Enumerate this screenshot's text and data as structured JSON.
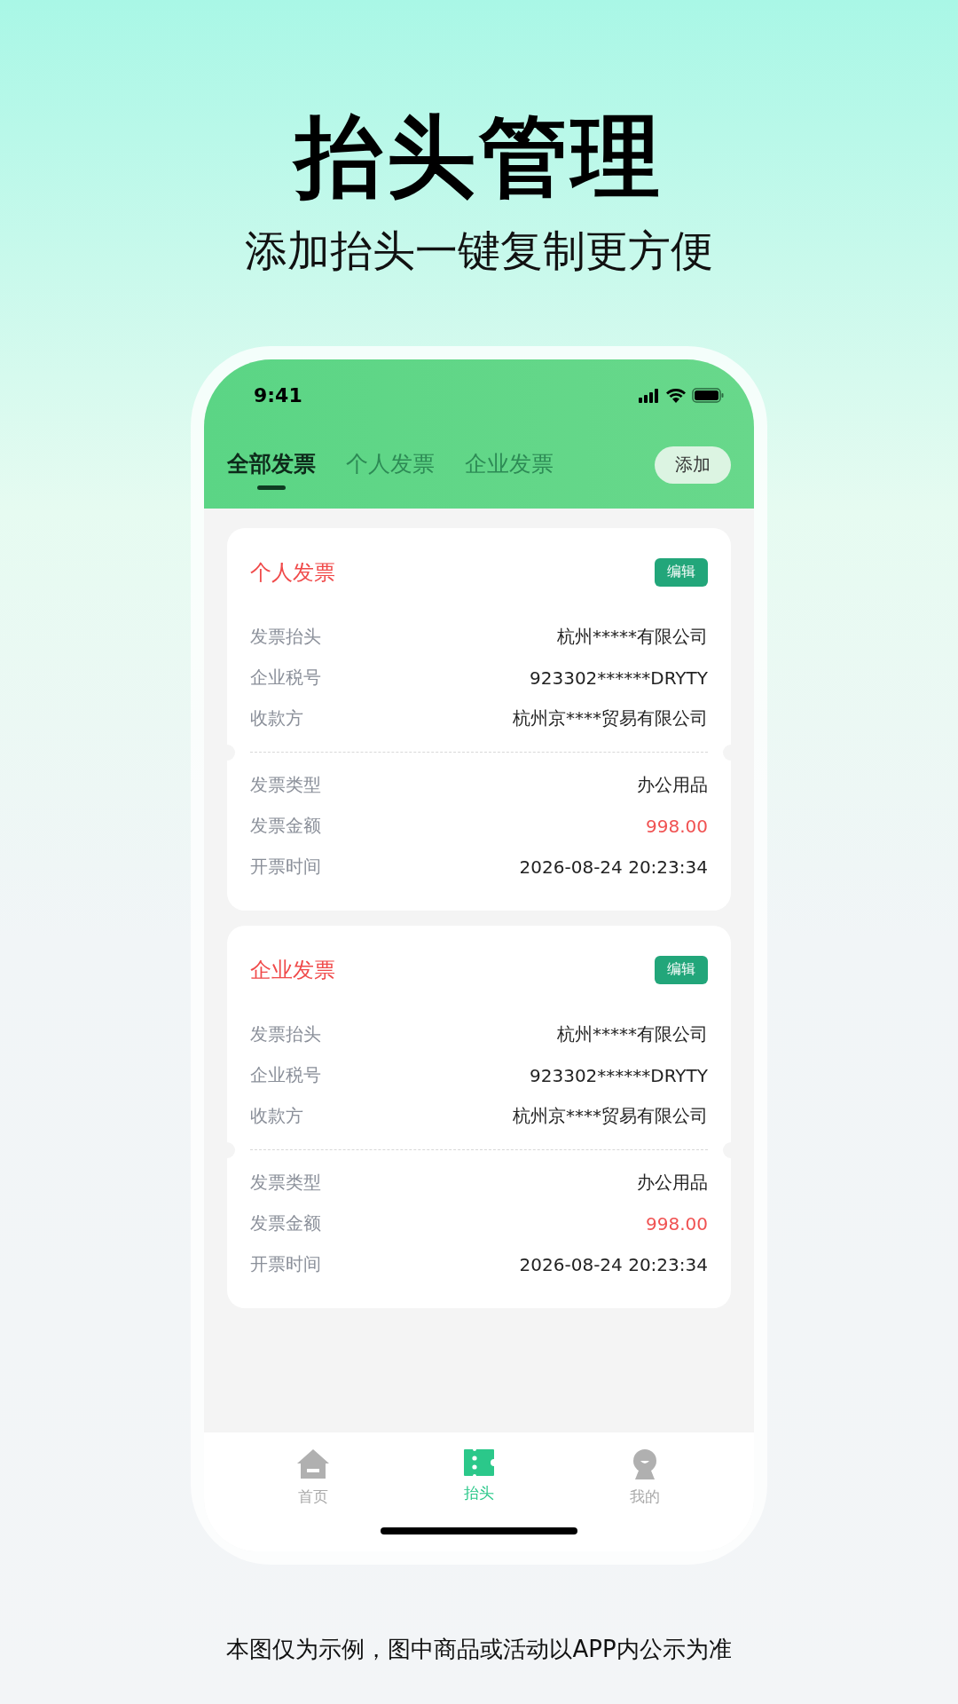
{
  "headline": "抬头管理",
  "subtitle": "添加抬头一键复制更方便",
  "status_bar": {
    "time": "9:41"
  },
  "tabs": [
    {
      "label": "全部发票",
      "selected": true
    },
    {
      "label": "个人发票",
      "selected": false
    },
    {
      "label": "企业发票",
      "selected": false
    }
  ],
  "add_button": "添加",
  "cards": [
    {
      "title": "个人发票",
      "edit_button": "编辑",
      "top_rows": [
        {
          "label": "发票抬头",
          "value": "杭州*****有限公司",
          "highlight": false
        },
        {
          "label": "企业税号",
          "value": "923302******DRYTY",
          "highlight": false
        },
        {
          "label": "收款方",
          "value": "杭州京****贸易有限公司",
          "highlight": false
        }
      ],
      "bottom_rows": [
        {
          "label": "发票类型",
          "value": "办公用品",
          "highlight": false
        },
        {
          "label": "发票金额",
          "value": "998.00",
          "highlight": true
        },
        {
          "label": "开票时间",
          "value": "2026-08-24 20:23:34",
          "highlight": false
        }
      ]
    },
    {
      "title": "企业发票",
      "edit_button": "编辑",
      "top_rows": [
        {
          "label": "发票抬头",
          "value": "杭州*****有限公司",
          "highlight": false
        },
        {
          "label": "企业税号",
          "value": "923302******DRYTY",
          "highlight": false
        },
        {
          "label": "收款方",
          "value": "杭州京****贸易有限公司",
          "highlight": false
        }
      ],
      "bottom_rows": [
        {
          "label": "发票类型",
          "value": "办公用品",
          "highlight": false
        },
        {
          "label": "发票金额",
          "value": "998.00",
          "highlight": true
        },
        {
          "label": "开票时间",
          "value": "2026-08-24 20:23:34",
          "highlight": false
        }
      ]
    }
  ],
  "bottom_nav": [
    {
      "label": "首页",
      "kind": "home",
      "selected": false
    },
    {
      "label": "抬头",
      "kind": "ticket",
      "selected": true
    },
    {
      "label": "我的",
      "kind": "profile",
      "selected": false
    }
  ],
  "footer": "本图仅为示例，图中商品或活动以APP内公示为准"
}
